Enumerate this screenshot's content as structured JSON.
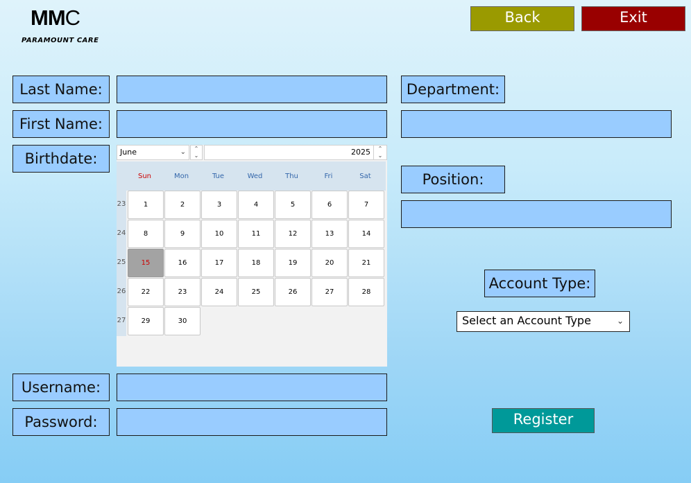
{
  "logo": {
    "mark_bold": "MM",
    "mark_rest": "C",
    "subtitle": "PARAMOUNT CARE"
  },
  "top_buttons": {
    "back": "Back",
    "exit": "Exit"
  },
  "labels": {
    "last_name": "Last Name:",
    "first_name": "First Name:",
    "birthdate": "Birthdate:",
    "username": "Username:",
    "password": "Password:",
    "department": "Department:",
    "position": "Position:",
    "account_type": "Account Type:"
  },
  "fields": {
    "last_name": "",
    "first_name": "",
    "username": "",
    "password": "",
    "department": "",
    "position": ""
  },
  "calendar": {
    "month": "June",
    "year": "2025",
    "weekdays": [
      "Sun",
      "Mon",
      "Tue",
      "Wed",
      "Thu",
      "Fri",
      "Sat"
    ],
    "week_numbers": [
      "23",
      "24",
      "25",
      "26",
      "27"
    ],
    "weeks": [
      [
        "1",
        "2",
        "3",
        "4",
        "5",
        "6",
        "7"
      ],
      [
        "8",
        "9",
        "10",
        "11",
        "12",
        "13",
        "14"
      ],
      [
        "15",
        "16",
        "17",
        "18",
        "19",
        "20",
        "21"
      ],
      [
        "22",
        "23",
        "24",
        "25",
        "26",
        "27",
        "28"
      ],
      [
        "29",
        "30"
      ]
    ],
    "selected_day": "15"
  },
  "account_type_select": {
    "selected": "Select an Account Type",
    "icon": "chevron-down-icon"
  },
  "register_button": "Register",
  "colors": {
    "field_bg": "#99ccff",
    "back_button": "#9a9a00",
    "exit_button": "#990000",
    "register_button": "#009999",
    "selected_day_bg": "#a3a3a3"
  }
}
